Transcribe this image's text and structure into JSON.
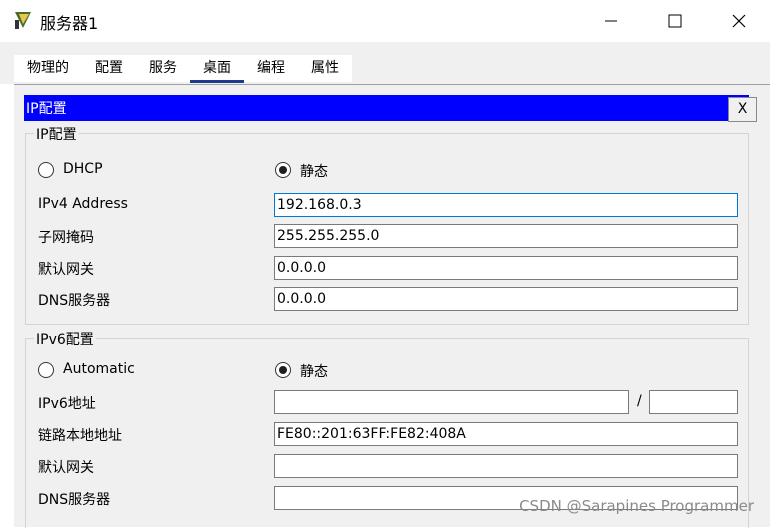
{
  "window": {
    "title": "服务器1"
  },
  "tabs": [
    {
      "label": "物理的",
      "active": false
    },
    {
      "label": "配置",
      "active": false
    },
    {
      "label": "服务",
      "active": false
    },
    {
      "label": "桌面",
      "active": true
    },
    {
      "label": "编程",
      "active": false
    },
    {
      "label": "属性",
      "active": false
    }
  ],
  "panel": {
    "title": "IP配置",
    "close_label": "X"
  },
  "ipv4": {
    "section_title": "IP配置",
    "mode_dhcp": "DHCP",
    "mode_static": "静态",
    "selected_mode": "静态",
    "rows": [
      {
        "label": "IPv4 Address",
        "value": "192.168.0.3"
      },
      {
        "label": "子网掩码",
        "value": "255.255.255.0"
      },
      {
        "label": "默认网关",
        "value": "0.0.0.0"
      },
      {
        "label": "DNS服务器",
        "value": "0.0.0.0"
      }
    ]
  },
  "ipv6": {
    "section_title": "IPv6配置",
    "mode_auto": "Automatic",
    "mode_static": "静态",
    "selected_mode": "静态",
    "address_label": "IPv6地址",
    "address_value": "",
    "prefix_separator": "/",
    "prefix_value": "",
    "rows": [
      {
        "label": "链路本地地址",
        "value": "FE80::201:63FF:FE82:408A"
      },
      {
        "label": "默认网关",
        "value": ""
      },
      {
        "label": "DNS服务器",
        "value": ""
      }
    ]
  },
  "watermark": "CSDN @Sarapines Programmer",
  "colors": {
    "panel_header": "#0000ff",
    "focus_border": "#0078d7",
    "tab_underline": "#1e3a8a"
  }
}
